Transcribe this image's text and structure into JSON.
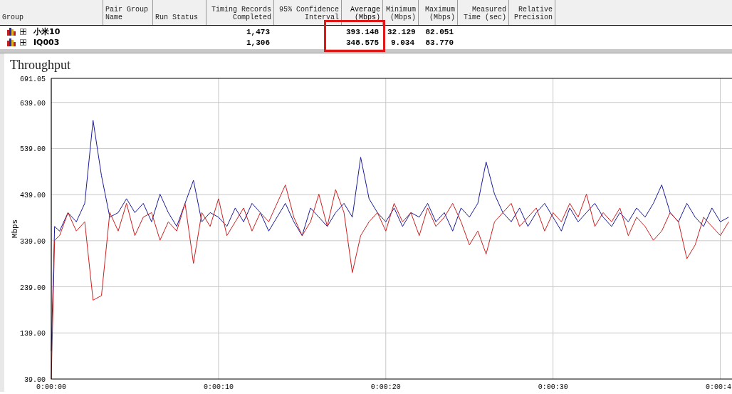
{
  "table": {
    "columns": [
      {
        "lines": [
          "Group"
        ],
        "highlighted": false
      },
      {
        "lines": [
          "Pair Group",
          "Name"
        ],
        "highlighted": false
      },
      {
        "lines": [
          "Run Status"
        ],
        "highlighted": false
      },
      {
        "lines": [
          "Timing Records",
          "Completed"
        ],
        "highlighted": false
      },
      {
        "lines": [
          "95% Confidence",
          "Interval"
        ],
        "highlighted": false
      },
      {
        "lines": [
          "Average",
          "(Mbps)"
        ],
        "highlighted": true
      },
      {
        "lines": [
          "Minimum",
          "(Mbps)"
        ],
        "highlighted": false
      },
      {
        "lines": [
          "Maximum",
          "(Mbps)"
        ],
        "highlighted": false
      },
      {
        "lines": [
          "Measured",
          "Time (sec)"
        ],
        "highlighted": false
      },
      {
        "lines": [
          "Relative",
          "Precision"
        ],
        "highlighted": false
      }
    ],
    "rows": [
      {
        "group": "小米10",
        "expanded": false,
        "timing_records": "1,473",
        "average": "393.148",
        "minimum": "32.129",
        "maximum": "82.051"
      },
      {
        "group": "IQ003",
        "expanded": false,
        "timing_records": "1,306",
        "average": "348.575",
        "minimum": "9.034",
        "maximum": "83.770"
      }
    ]
  },
  "chart": {
    "chart_data": {
      "type": "line",
      "grid": true,
      "title": "Throughput",
      "ylabel": "Mbps",
      "xlim": [
        0,
        40.7
      ],
      "ylim": [
        39,
        691.05
      ],
      "xticks": [
        {
          "value": 0,
          "label": "0:00:00"
        },
        {
          "value": 10,
          "label": "0:00:10"
        },
        {
          "value": 20,
          "label": "0:00:20"
        },
        {
          "value": 30,
          "label": "0:00:30"
        },
        {
          "value": 40,
          "label": "0:00:4"
        }
      ],
      "yticks": [
        {
          "value": 39,
          "label": "39.00"
        },
        {
          "value": 139,
          "label": "139.00"
        },
        {
          "value": 239,
          "label": "239.00"
        },
        {
          "value": 339,
          "label": "339.00"
        },
        {
          "value": 439,
          "label": "439.00"
        },
        {
          "value": 539,
          "label": "539.00"
        },
        {
          "value": 639,
          "label": "639.00"
        },
        {
          "value": 691.05,
          "label": "691.05"
        }
      ],
      "x": [
        0,
        0.2,
        0.5,
        1,
        1.5,
        2,
        2.5,
        3,
        3.5,
        4,
        4.5,
        5,
        5.5,
        6,
        6.5,
        7,
        7.5,
        8,
        8.5,
        9,
        9.5,
        10,
        10.5,
        11,
        11.5,
        12,
        12.5,
        13,
        13.5,
        14,
        14.5,
        15,
        15.5,
        16,
        16.5,
        17,
        17.5,
        18,
        18.5,
        19,
        19.5,
        20,
        20.5,
        21,
        21.5,
        22,
        22.5,
        23,
        23.5,
        24,
        24.5,
        25,
        25.5,
        26,
        26.5,
        27,
        27.5,
        28,
        28.5,
        29,
        29.5,
        30,
        30.5,
        31,
        31.5,
        32,
        32.5,
        33,
        33.5,
        34,
        34.5,
        35,
        35.5,
        36,
        36.5,
        37,
        37.5,
        38,
        38.5,
        39,
        39.5,
        40,
        40.5
      ],
      "series": [
        {
          "color": "#1a1a9a",
          "values": [
            100,
            370,
            360,
            400,
            380,
            420,
            600,
            480,
            390,
            400,
            430,
            400,
            420,
            380,
            440,
            400,
            370,
            420,
            470,
            380,
            400,
            390,
            370,
            410,
            380,
            420,
            400,
            360,
            390,
            420,
            380,
            350,
            410,
            390,
            370,
            400,
            420,
            390,
            520,
            430,
            400,
            380,
            410,
            370,
            400,
            390,
            420,
            380,
            400,
            360,
            410,
            390,
            420,
            510,
            440,
            400,
            380,
            410,
            370,
            400,
            420,
            390,
            360,
            410,
            380,
            400,
            420,
            390,
            370,
            400,
            380,
            410,
            390,
            420,
            460,
            400,
            380,
            420,
            390,
            370,
            410,
            380,
            390
          ]
        },
        {
          "color": "#cc2020",
          "values": [
            39,
            340,
            350,
            400,
            360,
            380,
            210,
            220,
            400,
            360,
            420,
            350,
            390,
            400,
            340,
            380,
            360,
            420,
            290,
            400,
            370,
            430,
            350,
            380,
            410,
            360,
            400,
            380,
            420,
            460,
            390,
            350,
            380,
            440,
            370,
            450,
            400,
            270,
            350,
            380,
            400,
            360,
            420,
            380,
            400,
            350,
            410,
            370,
            390,
            420,
            380,
            330,
            360,
            310,
            380,
            400,
            420,
            370,
            390,
            410,
            360,
            400,
            380,
            420,
            390,
            440,
            370,
            400,
            380,
            410,
            350,
            390,
            370,
            340,
            360,
            400,
            380,
            300,
            330,
            390,
            370,
            350,
            380
          ]
        }
      ]
    }
  }
}
